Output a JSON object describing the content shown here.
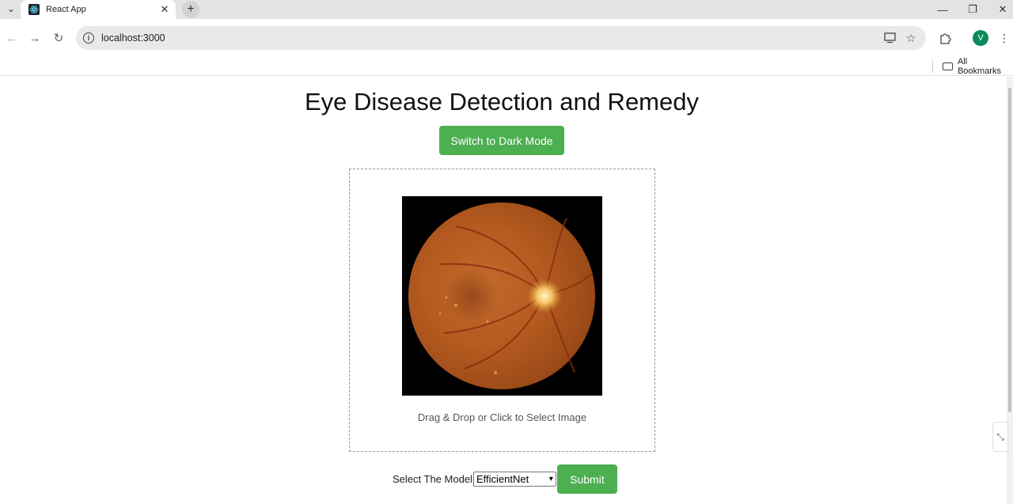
{
  "browser": {
    "tab_title": "React App",
    "url": "localhost:3000",
    "avatar_initial": "V",
    "bookmarks_label": "All Bookmarks"
  },
  "app": {
    "title": "Eye Disease Detection and Remedy",
    "theme_button": "Switch to Dark Mode",
    "dropzone_text": "Drag & Drop or Click to Select Image",
    "model_label": "Select The Model",
    "model_selected": "EfficientNet",
    "submit_label": "Submit",
    "accent_color": "#4caf50"
  },
  "icons": {
    "back": "back-arrow-icon",
    "forward": "forward-arrow-icon",
    "reload": "reload-icon",
    "info": "site-info-icon",
    "install": "install-app-icon",
    "bookmark": "star-icon",
    "extensions": "puzzle-icon",
    "menu": "kebab-menu-icon",
    "folder": "folder-icon"
  }
}
